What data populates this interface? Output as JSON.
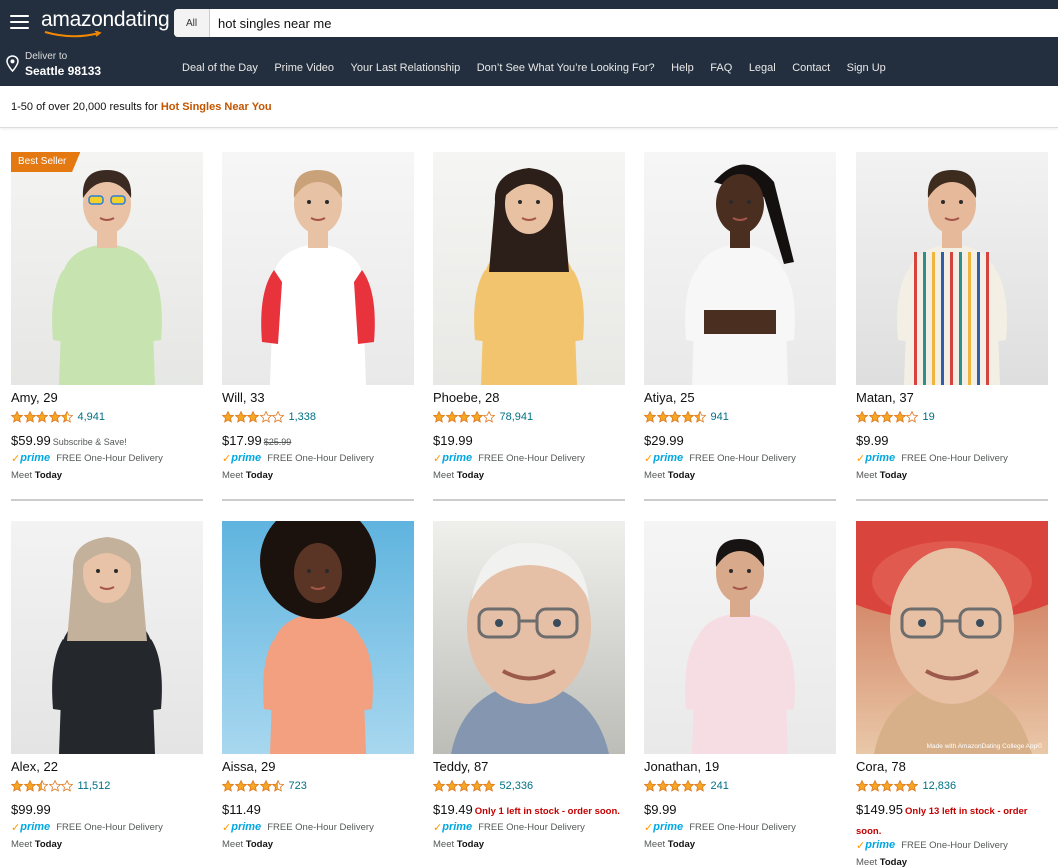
{
  "header": {
    "logo": "amazondating",
    "search": {
      "category": "All",
      "value": "hot singles near me"
    },
    "deliver": {
      "line1": "Deliver to",
      "line2": "Seattle 98133"
    },
    "nav": [
      "Deal of the Day",
      "Prime Video",
      "Your Last Relationship",
      "Don’t See What You’re Looking For?",
      "Help",
      "FAQ",
      "Legal",
      "Contact",
      "Sign Up"
    ]
  },
  "results": {
    "prefix": "1-50 of over 20,000 results for ",
    "query": "Hot Singles Near You"
  },
  "colors": {
    "header_bg": "#232f3e",
    "star": "#f5a623",
    "link": "#007185",
    "accent_orange": "#e47911",
    "query": "#c45500",
    "prime_blue": "#00a8e1",
    "stock_red": "#c40000"
  },
  "common": {
    "prime_label": "prime",
    "delivery": "FREE One-Hour Delivery",
    "meet_prefix": "Meet ",
    "meet_day": "Today"
  },
  "products": [
    {
      "name": "Amy, 29",
      "stars": 4.5,
      "reviews": "4,941",
      "price": "$59.99",
      "note": "Subscribe & Save!",
      "badge": "Best Seller",
      "photo": "green-top"
    },
    {
      "name": "Will, 33",
      "stars": 3,
      "reviews": "1,338",
      "price": "$17.99",
      "old_price": "$25.99",
      "photo": "red-raglan"
    },
    {
      "name": "Phoebe, 28",
      "stars": 4,
      "reviews": "78,941",
      "price": "$19.99",
      "photo": "yellow-sweater"
    },
    {
      "name": "Atiya, 25",
      "stars": 4.5,
      "reviews": "941",
      "price": "$29.99",
      "photo": "white-crop"
    },
    {
      "name": "Matan, 37",
      "stars": 4,
      "reviews": "19",
      "price": "$9.99",
      "photo": "striped-shirt"
    },
    {
      "name": "Alex, 22",
      "stars": 2.5,
      "reviews": "11,512",
      "price": "$99.99",
      "photo": "denim-jacket"
    },
    {
      "name": "Aissa, 29",
      "stars": 4.5,
      "reviews": "723",
      "price": "$11.49",
      "photo": "peach-dress-sky"
    },
    {
      "name": "Teddy, 87",
      "stars": 5,
      "reviews": "52,336",
      "price": "$19.49",
      "stock": "Only 1 left in stock - order soon.",
      "photo": "older-man-glasses"
    },
    {
      "name": "Jonathan, 19",
      "stars": 5,
      "reviews": "241",
      "price": "$9.99",
      "photo": "pink-sweatshirt"
    },
    {
      "name": "Cora, 78",
      "stars": 5,
      "reviews": "12,836",
      "price": "$149.95",
      "stock": "Only 13 left in stock - order soon.",
      "watermark": "Made with AmazonDating College App©",
      "photo": "older-woman-red-hat"
    }
  ]
}
